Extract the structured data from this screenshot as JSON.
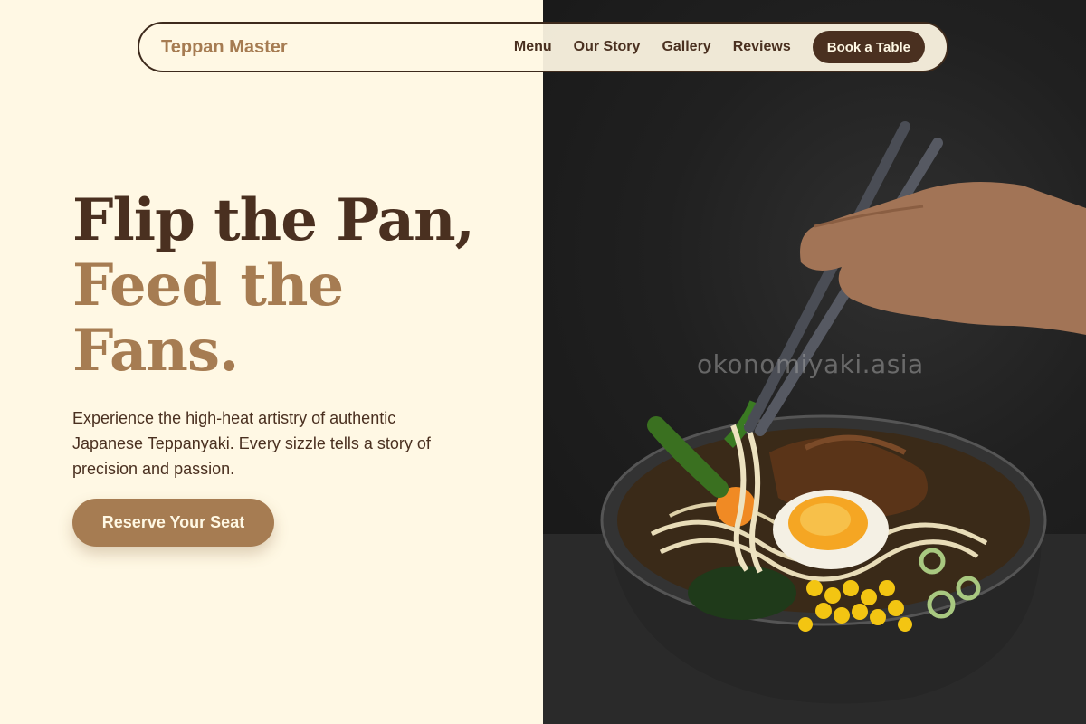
{
  "brand": {
    "name": "Teppan Master"
  },
  "nav": {
    "links": [
      "Menu",
      "Our Story",
      "Gallery",
      "Reviews"
    ],
    "cta_label": "Book a Table"
  },
  "hero": {
    "title_line1": "Flip the Pan,",
    "title_line2": "Feed the",
    "title_line3": "Fans.",
    "description": "Experience the high-heat artistry of authentic Japanese Teppanyaki. Every sizzle tells a story of precision and passion.",
    "cta_label": "Reserve Your Seat"
  },
  "image": {
    "watermark": "okonomiyaki.asia",
    "subject": "ramen-bowl-with-chopsticks"
  },
  "colors": {
    "cream": "#fff8e4",
    "dark_brown": "#4a3020",
    "light_brown": "#a67c52",
    "photo_bg": "#1c1c1c"
  }
}
